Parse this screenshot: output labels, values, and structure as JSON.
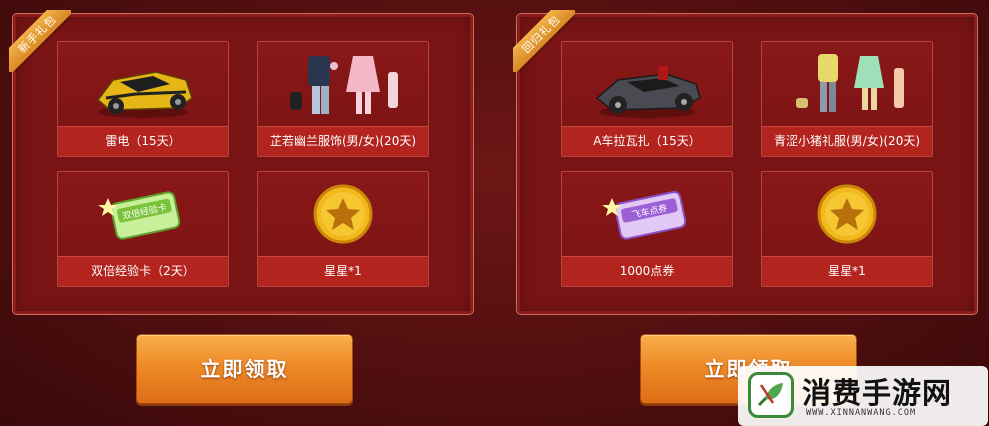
{
  "panels": [
    {
      "ribbon": "新手礼包",
      "items": [
        {
          "label": "雷电（15天）",
          "icon": "yellow-race-car-icon"
        },
        {
          "label": "芷若幽兰服饰(男/女)(20天)",
          "icon": "outfit-set-icon"
        },
        {
          "label": "双倍经验卡（2天）",
          "icon": "double-exp-card-icon"
        },
        {
          "label": "星星*1",
          "icon": "gold-star-coin-icon"
        }
      ],
      "button": "立即领取"
    },
    {
      "ribbon": "回归礼包",
      "items": [
        {
          "label": "A车拉瓦扎（15天）",
          "icon": "black-race-car-icon"
        },
        {
          "label": "青涩小猪礼服(男/女)(20天)",
          "icon": "pig-outfit-set-icon"
        },
        {
          "label": "1000点券",
          "icon": "coupon-card-icon"
        },
        {
          "label": "星星*1",
          "icon": "gold-star-coin-icon"
        }
      ],
      "button": "立即领取"
    }
  ],
  "card_text": {
    "double_exp": "双倍经验卡",
    "coupon": "飞车点券"
  },
  "watermark": {
    "brand": "消费手游网",
    "url": "WWW.XINNANWANG.COM"
  },
  "colors": {
    "panel": "#7a1414",
    "caption": "#b3241f",
    "button": "#ee8a27",
    "ribbon": "#e39a32"
  }
}
